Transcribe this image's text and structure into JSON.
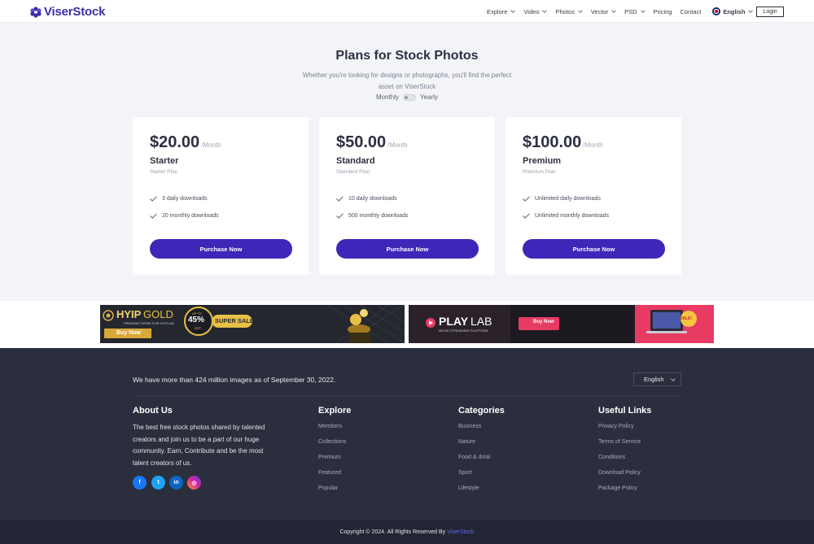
{
  "colors": {
    "brand": "#3e27b8",
    "footer_bg": "#2b2e3d",
    "copyright_bg": "#222533",
    "brand_link": "#5b6cf0"
  },
  "header": {
    "logo_text": "ViserStock",
    "logo_icon": "hexagon-flower-logo-icon",
    "nav": [
      {
        "label": "Explore",
        "dropdown": true
      },
      {
        "label": "Video",
        "dropdown": true
      },
      {
        "label": "Photos",
        "dropdown": true
      },
      {
        "label": "Vector",
        "dropdown": true
      },
      {
        "label": "PSD",
        "dropdown": true
      },
      {
        "label": "Pricing",
        "dropdown": false
      },
      {
        "label": "Contact",
        "dropdown": false
      }
    ],
    "language": "English",
    "login": "Login"
  },
  "pricing": {
    "title": "Plans for Stock Photos",
    "subtitle": "Whether you're looking for designs or photographs, you'll find the perfect asset on ViserStock",
    "toggle": {
      "left": "Monthly",
      "right": "Yearly",
      "selected": "Monthly"
    },
    "plans": [
      {
        "price": "$20.00",
        "period": "/Month",
        "name": "Starter",
        "desc": "Starter Plan",
        "features": [
          "3 daily downloads",
          "20 monthly downloads"
        ],
        "button": "Purchase Now"
      },
      {
        "price": "$50.00",
        "period": "/Month",
        "name": "Standard",
        "desc": "Standard Plan",
        "features": [
          "10 daily downloads",
          "500 monthly downloads"
        ],
        "button": "Purchase Now"
      },
      {
        "price": "$100.00",
        "period": "/Month",
        "name": "Premium",
        "desc": "Premium Plan",
        "features": [
          "Unlimited daily downloads",
          "Unlimited monthly downloads"
        ],
        "button": "Purchase Now"
      }
    ]
  },
  "banners": {
    "hyip": {
      "brand": "HYIP",
      "brand2": "GOLD",
      "tagline": "PREMIUM THEME FOR HYIPLAB",
      "badge_top": "UP TO",
      "badge_value": "45%",
      "badge_bottom": "OFF",
      "sale": "SUPER SALE",
      "cta": "Buy Now"
    },
    "playlab": {
      "brand": "PLAY",
      "brand2": "LAB",
      "tagline": "MOVIE STREAMING PLATFORM",
      "cta": "Buy Now",
      "sale": "SALE!"
    }
  },
  "footer": {
    "stat": "We have more than 424 million images as of September 30, 2022.",
    "language": "English",
    "about": {
      "title": "About Us",
      "text": "The best free stock photos shared by talented creators and join us to be a part of our huge community. Earn, Contribute and be the most talent creators of us."
    },
    "social": [
      {
        "icon": "facebook-icon",
        "glyph": "f",
        "color": "#1877f2"
      },
      {
        "icon": "twitter-icon",
        "glyph": "t",
        "color": "#1da1f2"
      },
      {
        "icon": "linkedin-icon",
        "glyph": "in",
        "color": "#0a66c2"
      },
      {
        "icon": "instagram-icon",
        "glyph": "◎",
        "color": "#d6249f"
      }
    ],
    "columns": [
      {
        "title": "Explore",
        "links": [
          "Members",
          "Collections",
          "Premium",
          "Featured",
          "Popular"
        ]
      },
      {
        "title": "Categories",
        "links": [
          "Business",
          "Nature",
          "Food & drink",
          "Sport",
          "Lifestyle"
        ]
      },
      {
        "title": "Useful Links",
        "links": [
          "Privacy Policy",
          "Terms of Service",
          "Conditions",
          "Download Policy",
          "Package Policy"
        ]
      }
    ],
    "copyright": "Copyright © 2024. All Rights Reserved By",
    "copyright_brand": "ViserStock"
  }
}
